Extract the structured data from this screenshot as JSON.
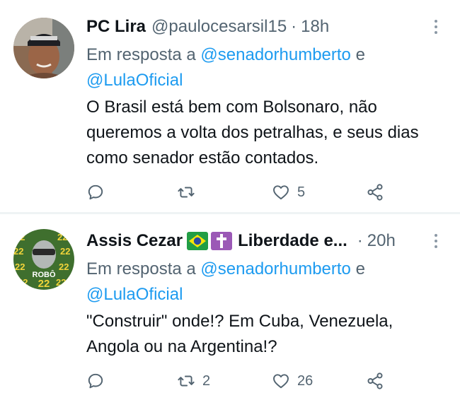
{
  "tweets": [
    {
      "display_name": "PC Lira",
      "handle": "@paulocesarsil15",
      "separator": "·",
      "time": "18h",
      "reply_prefix": "Em resposta a",
      "mention_1": "@senadorhumberto",
      "reply_conjunction": "e",
      "mention_2": "@LulaOficial",
      "text": "O Brasil está bem com Bolsonaro, não queremos a volta dos petralhas, e seus dias como senador estão contados.",
      "reply_count": "",
      "retweet_count": "",
      "like_count": "5"
    },
    {
      "display_name": "Assis Cezar",
      "display_name_suffix": "Liberdade e...",
      "handle": "",
      "separator": "·",
      "time": "20h",
      "reply_prefix": "Em resposta a",
      "mention_1": "@senadorhumberto",
      "reply_conjunction": "e",
      "mention_2": "@LulaOficial",
      "text": "\"Construir\" onde!? Em Cuba, Venezuela, Angola ou na Argentina!?",
      "avatar_text": "ROBÔ 22",
      "reply_count": "",
      "retweet_count": "2",
      "like_count": "26"
    }
  ],
  "icons": {
    "reply": "reply-icon",
    "retweet": "retweet-icon",
    "like": "heart-icon",
    "share": "share-icon",
    "more": "more-icon",
    "flag": "brazil-flag-emoji",
    "cross": "latin-cross-emoji"
  },
  "colors": {
    "name": "#0f1419",
    "secondary": "#536471",
    "link": "#1d9bf0",
    "divider": "#eff3f4"
  }
}
